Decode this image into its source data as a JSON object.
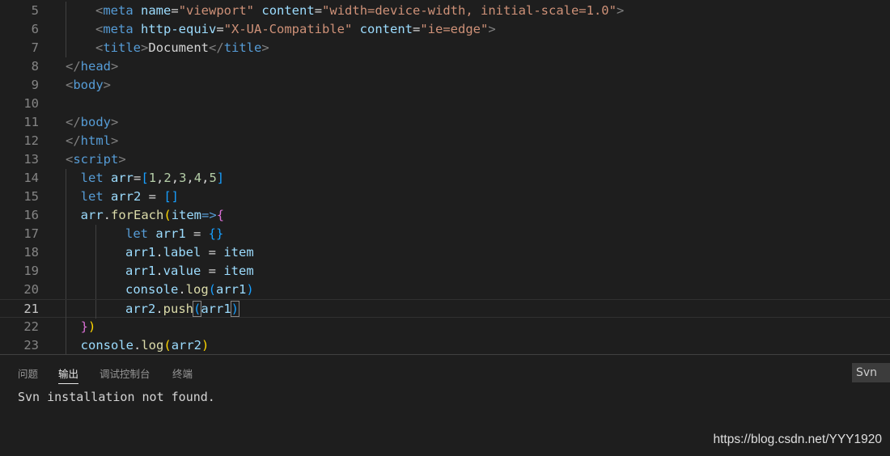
{
  "editor": {
    "current_line": "21",
    "lines": [
      {
        "n": "5",
        "ind": 1,
        "tokens": [
          [
            "t-punct",
            "<"
          ],
          [
            "t-tag",
            "meta"
          ],
          [
            "t-text",
            " "
          ],
          [
            "t-attr",
            "name"
          ],
          [
            "t-text",
            "="
          ],
          [
            "t-str",
            "\"viewport\""
          ],
          [
            "t-text",
            " "
          ],
          [
            "t-attr",
            "content"
          ],
          [
            "t-text",
            "="
          ],
          [
            "t-str",
            "\"width=device-width, initial-scale=1.0\""
          ],
          [
            "t-punct",
            ">"
          ]
        ]
      },
      {
        "n": "6",
        "ind": 1,
        "tokens": [
          [
            "t-punct",
            "<"
          ],
          [
            "t-tag",
            "meta"
          ],
          [
            "t-text",
            " "
          ],
          [
            "t-attr",
            "http-equiv"
          ],
          [
            "t-text",
            "="
          ],
          [
            "t-str",
            "\"X-UA-Compatible\""
          ],
          [
            "t-text",
            " "
          ],
          [
            "t-attr",
            "content"
          ],
          [
            "t-text",
            "="
          ],
          [
            "t-str",
            "\"ie=edge\""
          ],
          [
            "t-punct",
            ">"
          ]
        ]
      },
      {
        "n": "7",
        "ind": 1,
        "tokens": [
          [
            "t-punct",
            "<"
          ],
          [
            "t-tag",
            "title"
          ],
          [
            "t-punct",
            ">"
          ],
          [
            "t-text",
            "Document"
          ],
          [
            "t-punct",
            "</"
          ],
          [
            "t-tag",
            "title"
          ],
          [
            "t-punct",
            ">"
          ]
        ]
      },
      {
        "n": "8",
        "ind": 0,
        "tokens": [
          [
            "t-punct",
            "</"
          ],
          [
            "t-tag",
            "head"
          ],
          [
            "t-punct",
            ">"
          ]
        ]
      },
      {
        "n": "9",
        "ind": 0,
        "tokens": [
          [
            "t-punct",
            "<"
          ],
          [
            "t-tag",
            "body"
          ],
          [
            "t-punct",
            ">"
          ]
        ]
      },
      {
        "n": "10",
        "ind": 0,
        "tokens": []
      },
      {
        "n": "11",
        "ind": 0,
        "tokens": [
          [
            "t-punct",
            "</"
          ],
          [
            "t-tag",
            "body"
          ],
          [
            "t-punct",
            ">"
          ]
        ]
      },
      {
        "n": "12",
        "ind": 0,
        "tokens": [
          [
            "t-punct",
            "</"
          ],
          [
            "t-tag",
            "html"
          ],
          [
            "t-punct",
            ">"
          ]
        ]
      },
      {
        "n": "13",
        "ind": 0,
        "tokens": [
          [
            "t-punct",
            "<"
          ],
          [
            "t-tag",
            "script"
          ],
          [
            "t-punct",
            ">"
          ]
        ]
      },
      {
        "n": "14",
        "ind": 0,
        "pre": "  ",
        "tokens": [
          [
            "t-kw",
            "let"
          ],
          [
            "t-text",
            " "
          ],
          [
            "t-var",
            "arr"
          ],
          [
            "t-op",
            "="
          ],
          [
            "t-br3",
            "["
          ],
          [
            "t-num",
            "1"
          ],
          [
            "t-op",
            ","
          ],
          [
            "t-num",
            "2"
          ],
          [
            "t-op",
            ","
          ],
          [
            "t-num",
            "3"
          ],
          [
            "t-op",
            ","
          ],
          [
            "t-num",
            "4"
          ],
          [
            "t-op",
            ","
          ],
          [
            "t-num",
            "5"
          ],
          [
            "t-br3",
            "]"
          ]
        ]
      },
      {
        "n": "15",
        "ind": 0,
        "pre": "  ",
        "tokens": [
          [
            "t-kw",
            "let"
          ],
          [
            "t-text",
            " "
          ],
          [
            "t-var",
            "arr2"
          ],
          [
            "t-op",
            " = "
          ],
          [
            "t-br3",
            "[]"
          ]
        ]
      },
      {
        "n": "16",
        "ind": 0,
        "pre": "  ",
        "tokens": [
          [
            "t-var",
            "arr"
          ],
          [
            "t-op",
            "."
          ],
          [
            "t-fn",
            "forEach"
          ],
          [
            "t-br1",
            "("
          ],
          [
            "t-var",
            "item"
          ],
          [
            "t-arrow",
            "=>"
          ],
          [
            "t-br2",
            "{"
          ]
        ]
      },
      {
        "n": "17",
        "ind": 2,
        "tokens": [
          [
            "t-kw",
            "let"
          ],
          [
            "t-text",
            " "
          ],
          [
            "t-var",
            "arr1"
          ],
          [
            "t-op",
            " = "
          ],
          [
            "t-br3",
            "{}"
          ]
        ]
      },
      {
        "n": "18",
        "ind": 2,
        "tokens": [
          [
            "t-var",
            "arr1"
          ],
          [
            "t-op",
            "."
          ],
          [
            "t-var",
            "label"
          ],
          [
            "t-op",
            " = "
          ],
          [
            "t-var",
            "item"
          ]
        ]
      },
      {
        "n": "19",
        "ind": 2,
        "tokens": [
          [
            "t-var",
            "arr1"
          ],
          [
            "t-op",
            "."
          ],
          [
            "t-var",
            "value"
          ],
          [
            "t-op",
            " = "
          ],
          [
            "t-var",
            "item"
          ]
        ]
      },
      {
        "n": "20",
        "ind": 2,
        "tokens": [
          [
            "t-var",
            "console"
          ],
          [
            "t-op",
            "."
          ],
          [
            "t-fn",
            "log"
          ],
          [
            "t-br3",
            "("
          ],
          [
            "t-var",
            "arr1"
          ],
          [
            "t-br3",
            ")"
          ]
        ]
      },
      {
        "n": "21",
        "ind": 2,
        "tokens": [
          [
            "t-var",
            "arr2"
          ],
          [
            "t-op",
            "."
          ],
          [
            "t-fn",
            "push"
          ],
          [
            "t-br3 t-match",
            "("
          ],
          [
            "t-var",
            "arr1"
          ],
          [
            "t-br3 t-match",
            ")"
          ]
        ]
      },
      {
        "n": "22",
        "ind": 0,
        "pre": "  ",
        "tokens": [
          [
            "t-br2",
            "}"
          ],
          [
            "t-br1",
            ")"
          ]
        ]
      },
      {
        "n": "23",
        "ind": 0,
        "pre": "  ",
        "tokens": [
          [
            "t-var",
            "console"
          ],
          [
            "t-op",
            "."
          ],
          [
            "t-fn",
            "log"
          ],
          [
            "t-br1",
            "("
          ],
          [
            "t-var",
            "arr2"
          ],
          [
            "t-br1",
            ")"
          ]
        ]
      }
    ]
  },
  "panel": {
    "tabs": [
      "问题",
      "输出",
      "调试控制台",
      "终端"
    ],
    "active_tab": "输出",
    "channel_button": "Svn",
    "output_text": "Svn installation not found."
  },
  "watermark": "https://blog.csdn.net/YYY1920",
  "colors": {
    "background": "#1e1e1e",
    "keyword": "#569cd6",
    "string": "#ce9178",
    "variable": "#9cdcfe",
    "function": "#dcdcaa"
  }
}
